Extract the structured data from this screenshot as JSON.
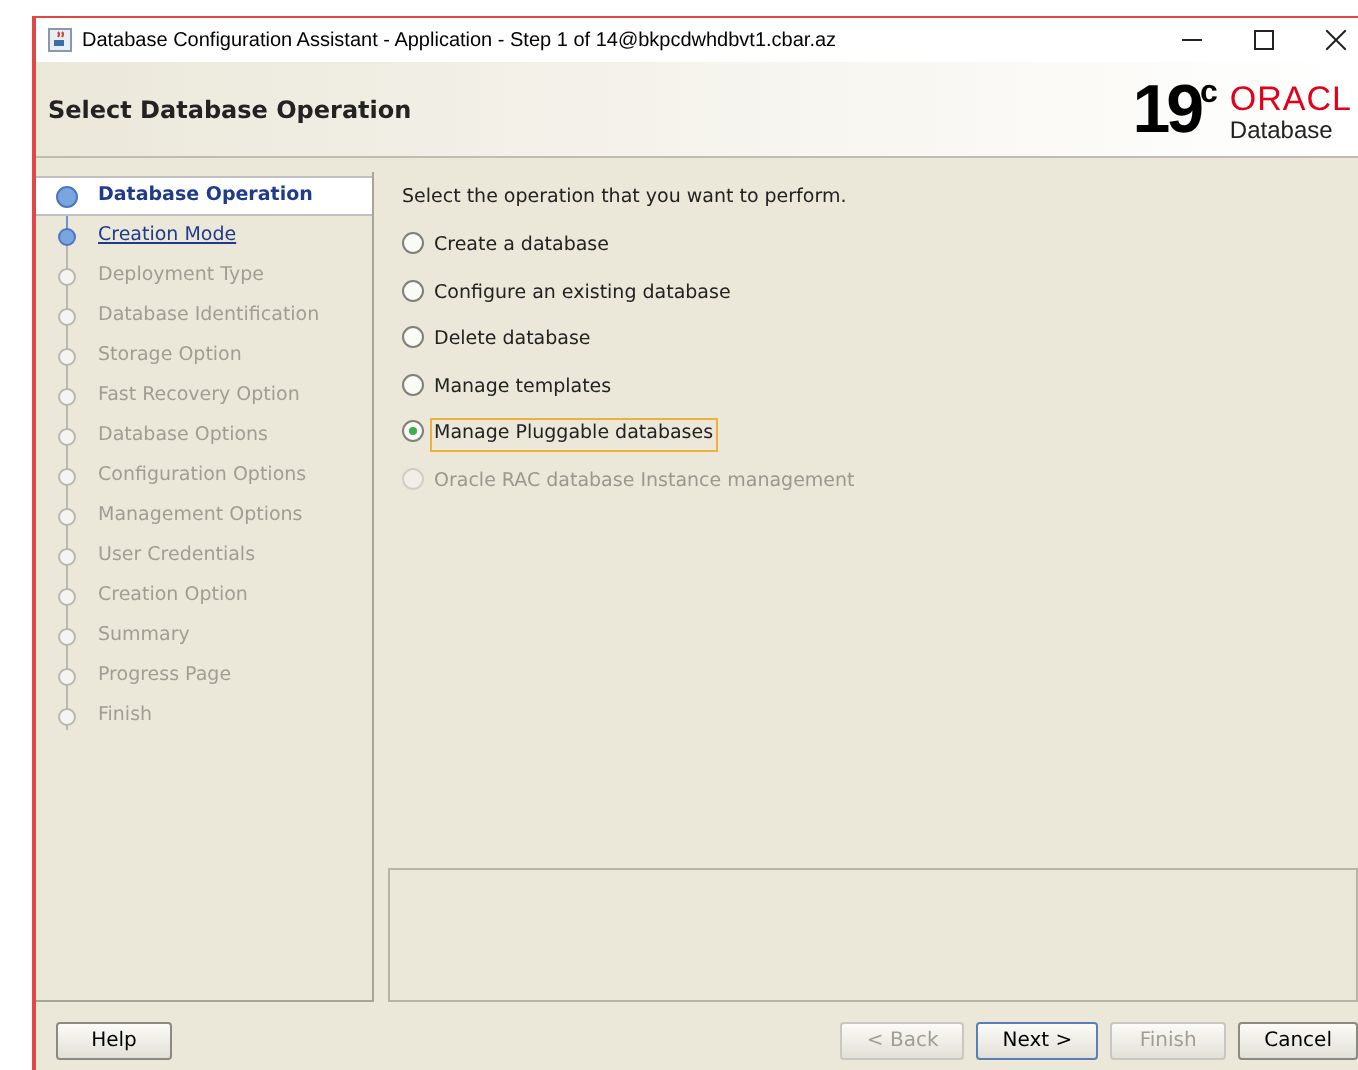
{
  "window": {
    "title": "Database Configuration Assistant - Application - Step 1 of 14@bkpcdwhdbvt1.cbar.az"
  },
  "header": {
    "title": "Select Database Operation",
    "logo_version": "19",
    "logo_superscript": "c",
    "logo_brand": "ORACL",
    "logo_product": "Database"
  },
  "steps": [
    {
      "label": "Database Operation",
      "selected": true,
      "disabled": false
    },
    {
      "label": "Creation Mode",
      "selected": false,
      "disabled": false
    },
    {
      "label": "Deployment Type",
      "selected": false,
      "disabled": true
    },
    {
      "label": "Database Identification",
      "selected": false,
      "disabled": true
    },
    {
      "label": "Storage Option",
      "selected": false,
      "disabled": true
    },
    {
      "label": "Fast Recovery Option",
      "selected": false,
      "disabled": true
    },
    {
      "label": "Database Options",
      "selected": false,
      "disabled": true
    },
    {
      "label": "Configuration Options",
      "selected": false,
      "disabled": true
    },
    {
      "label": "Management Options",
      "selected": false,
      "disabled": true
    },
    {
      "label": "User Credentials",
      "selected": false,
      "disabled": true
    },
    {
      "label": "Creation Option",
      "selected": false,
      "disabled": true
    },
    {
      "label": "Summary",
      "selected": false,
      "disabled": true
    },
    {
      "label": "Progress Page",
      "selected": false,
      "disabled": true
    },
    {
      "label": "Finish",
      "selected": false,
      "disabled": true
    }
  ],
  "prompt": "Select the operation that you want to perform.",
  "options": [
    {
      "label": "Create a database",
      "selected": false,
      "disabled": false
    },
    {
      "label": "Configure an existing database",
      "selected": false,
      "disabled": false
    },
    {
      "label": "Delete database",
      "selected": false,
      "disabled": false
    },
    {
      "label": "Manage templates",
      "selected": false,
      "disabled": false
    },
    {
      "label": "Manage Pluggable databases",
      "selected": true,
      "disabled": false
    },
    {
      "label": "Oracle RAC database Instance management",
      "selected": false,
      "disabled": true
    }
  ],
  "buttons_left": [
    {
      "label": "Help",
      "disabled": false,
      "default": false
    }
  ],
  "buttons_right": [
    {
      "label": "< Back",
      "disabled": true,
      "default": false
    },
    {
      "label": "Next >",
      "disabled": false,
      "default": true
    },
    {
      "label": "Finish",
      "disabled": true,
      "default": false
    },
    {
      "label": "Cancel",
      "disabled": false,
      "default": false
    }
  ]
}
